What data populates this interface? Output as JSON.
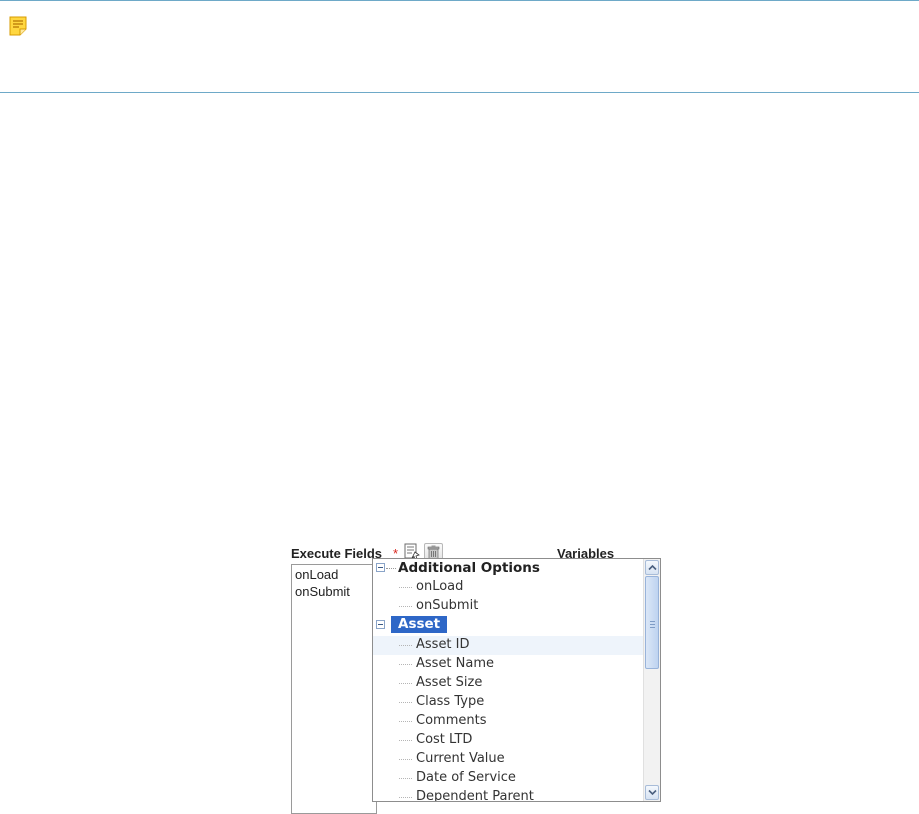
{
  "note_bar": {
    "icon": "note-icon"
  },
  "form": {
    "execute_fields_label": "Execute Fields",
    "required_marker": "*",
    "add_icon": "add-field-icon",
    "delete_icon": "trash-icon",
    "variables_label": "Variables"
  },
  "execute_list": {
    "items": [
      "onLoad",
      "onSubmit"
    ]
  },
  "variables_tree": {
    "groups": [
      {
        "label": "Additional Options",
        "expanded": true,
        "selected": false,
        "children": [
          "onLoad",
          "onSubmit"
        ]
      },
      {
        "label": "Asset",
        "expanded": true,
        "selected": true,
        "children": [
          "Asset ID",
          "Asset Name",
          "Asset Size",
          "Class Type",
          "Comments",
          "Cost LTD",
          "Current Value",
          "Date of Service",
          "Dependent Parent"
        ]
      }
    ],
    "hovered_item": "Asset ID",
    "scrollbar": {
      "up_icon": "chevron-up-icon",
      "down_icon": "chevron-down-icon",
      "position": 0.0
    }
  },
  "colors": {
    "note_border": "#6ea9c8",
    "note_icon": "#f2b400",
    "selected_bg": "#2e67c7",
    "required": "#d9251d"
  }
}
